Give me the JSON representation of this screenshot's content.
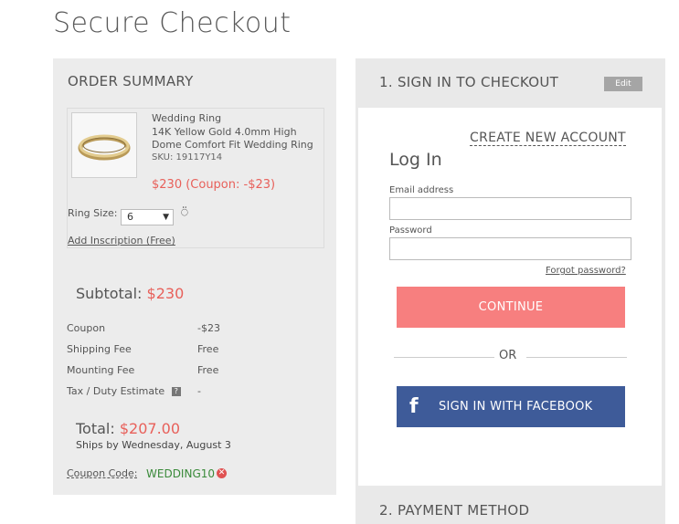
{
  "page": {
    "title": "Secure Checkout"
  },
  "summary": {
    "title": "ORDER SUMMARY",
    "product": {
      "name": "Wedding Ring",
      "description": "14K Yellow Gold 4.0mm High Dome Comfort Fit Wedding Ring",
      "sku": "SKU: 19117Y14",
      "price_line": "$230 (Coupon: -$23)"
    },
    "ring_size_label": "Ring Size:",
    "ring_size_value": "6",
    "inscription": "Add Inscription (Free)",
    "subtotal_label": "Subtotal:",
    "subtotal_value": "$230",
    "rows": [
      {
        "label": "Coupon",
        "value": "-$23"
      },
      {
        "label": "Shipping Fee",
        "value": "Free"
      },
      {
        "label": "Mounting Fee",
        "value": "Free"
      },
      {
        "label": "Tax / Duty Estimate",
        "value": "-",
        "help": "?"
      }
    ],
    "total_label": "Total:",
    "total_value": "$207.00",
    "ships": "Ships by Wednesday, August 3",
    "coupon_code_label": "Coupon Code:",
    "coupon_code_value": "WEDDING10"
  },
  "signin": {
    "title": "1. SIGN IN TO CHECKOUT",
    "edit": "Edit",
    "create_account": "CREATE NEW ACCOUNT",
    "login_heading": "Log In",
    "email_label": "Email address",
    "email_value": "",
    "password_label": "Password",
    "password_value": "",
    "forgot": "Forgot password?",
    "continue": "CONTINUE",
    "or": "OR",
    "facebook_icon_glyph": "f",
    "facebook": "SIGN IN WITH FACEBOOK"
  },
  "payment": {
    "title": "2. PAYMENT METHOD"
  },
  "colors": {
    "accent_red": "#e8605a",
    "continue_bg": "#f77f7f",
    "facebook_bg": "#3e5b99",
    "coupon_green": "#3a8a3a"
  }
}
